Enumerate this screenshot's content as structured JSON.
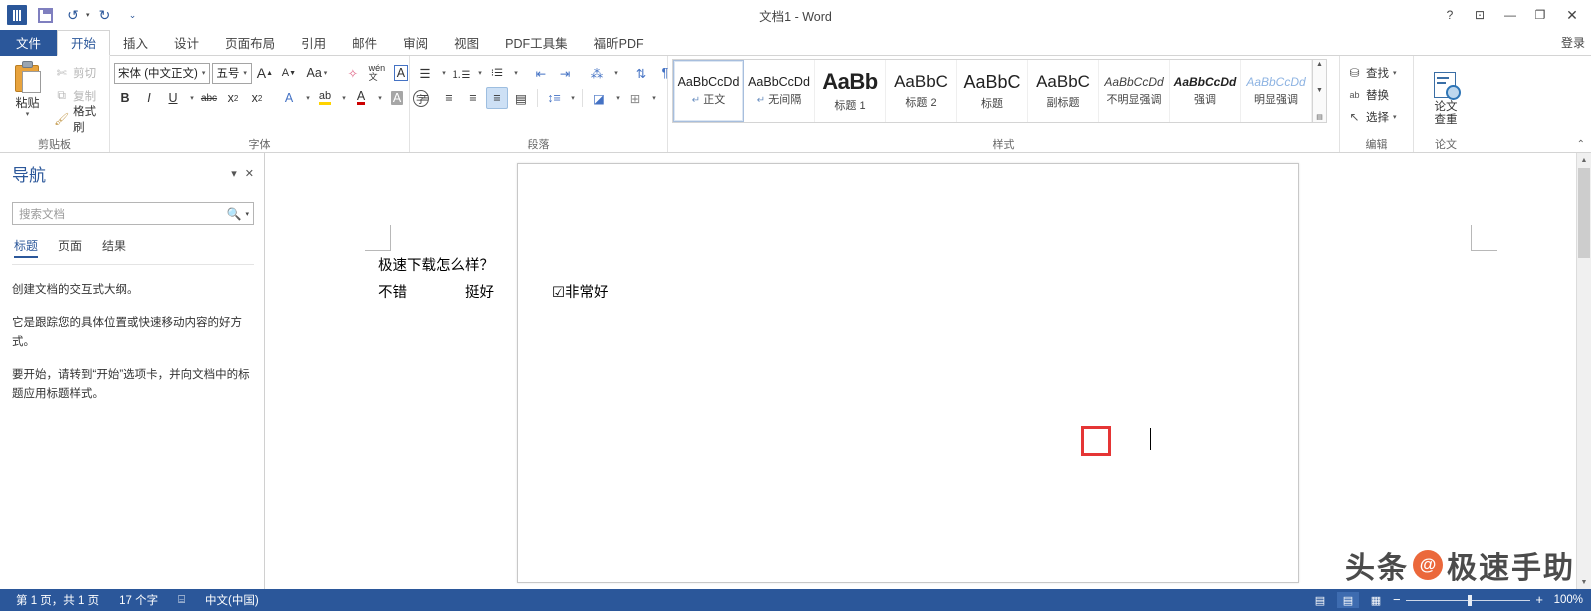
{
  "titlebar": {
    "document_title": "文档1 - Word",
    "quick_access": [
      {
        "name": "word-logo",
        "label": "W"
      },
      {
        "name": "save",
        "label": "保存"
      },
      {
        "name": "undo",
        "label": "↶"
      },
      {
        "name": "redo",
        "label": "↷"
      },
      {
        "name": "customize",
        "label": "⌄"
      }
    ],
    "window_buttons": [
      {
        "name": "help",
        "glyph": "?"
      },
      {
        "name": "ribbon-display-options",
        "glyph": "⊡"
      },
      {
        "name": "minimize",
        "glyph": "—"
      },
      {
        "name": "maximize",
        "glyph": "❐"
      },
      {
        "name": "close",
        "glyph": "✕"
      }
    ]
  },
  "tabs": {
    "file": "文件",
    "items": [
      "开始",
      "插入",
      "设计",
      "页面布局",
      "引用",
      "邮件",
      "审阅",
      "视图",
      "PDF工具集",
      "福昕PDF"
    ],
    "active": "开始",
    "signin": "登录"
  },
  "ribbon": {
    "clipboard": {
      "label": "剪贴板",
      "paste": "粘贴",
      "cut": "剪切",
      "copy": "复制",
      "format_painter": "格式刷"
    },
    "font": {
      "label": "字体",
      "font_name": "宋体 (中文正文)",
      "font_size": "五号",
      "grow_font": "A",
      "shrink_font": "A",
      "change_case": "Aa",
      "clear_format": "✧",
      "phonetic": "wén",
      "char_border": "A",
      "bold": "B",
      "italic": "I",
      "underline": "U",
      "strikethrough": "abc",
      "subscript": "x₂",
      "superscript": "x²",
      "text_effects": "A",
      "highlight": "ab",
      "font_color": "A",
      "char_shading": "A",
      "enclose_char": "字"
    },
    "paragraph": {
      "label": "段落",
      "bullets": "≔",
      "numbering": "≕",
      "multilevel": "≣",
      "decrease_indent": "⇤",
      "increase_indent": "⇥",
      "asian_layout": "⁂",
      "sort": "↓",
      "show_marks": "¶",
      "align_left": "≡",
      "align_center": "≡",
      "align_right": "≡",
      "justify": "≡",
      "distribute": "▤",
      "line_spacing": "↕",
      "shading": "◇",
      "borders": "⊞"
    },
    "styles": {
      "label": "样式",
      "items": [
        {
          "preview": "AaBbCcDd",
          "name": "正文",
          "pilcrow": true,
          "selected": true,
          "kind": "normal"
        },
        {
          "preview": "AaBbCcDd",
          "name": "无间隔",
          "pilcrow": true,
          "selected": false,
          "kind": "normal"
        },
        {
          "preview": "AaBb",
          "name": "标题 1",
          "pilcrow": false,
          "selected": false,
          "kind": "big"
        },
        {
          "preview": "AaBbC",
          "name": "标题 2",
          "pilcrow": false,
          "selected": false,
          "kind": "h1"
        },
        {
          "preview": "AaBbC",
          "name": "标题",
          "pilcrow": false,
          "selected": false,
          "kind": "title"
        },
        {
          "preview": "AaBbC",
          "name": "副标题",
          "pilcrow": false,
          "selected": false,
          "kind": "sub"
        },
        {
          "preview": "AaBbCcDd",
          "name": "不明显强调",
          "pilcrow": false,
          "selected": false,
          "kind": "em"
        },
        {
          "preview": "AaBbCcDd",
          "name": "强调",
          "pilcrow": false,
          "selected": false,
          "kind": "emi"
        },
        {
          "preview": "AaBbCcDd",
          "name": "明显强调",
          "pilcrow": false,
          "selected": false,
          "kind": "emb"
        }
      ]
    },
    "editing": {
      "label": "编辑",
      "find": "查找",
      "replace": "替换",
      "select": "选择"
    },
    "paper": {
      "label": "论文",
      "button_line1": "论文",
      "button_line2": "查重"
    },
    "collapse": "⌃"
  },
  "navigation": {
    "title": "导航",
    "close": "✕",
    "dropdown": "▾",
    "search_placeholder": "搜索文档",
    "search_value": "",
    "tabs": [
      "标题",
      "页面",
      "结果"
    ],
    "active_tab": "标题",
    "help": [
      "创建文档的交互式大纲。",
      "它是跟踪您的具体位置或快速移动内容的好方式。",
      "要开始，请转到“开始”选项卡，并向文档中的标题应用标题样式。"
    ]
  },
  "document": {
    "lines": [
      "极速下载怎么样？",
      {
        "before": "不错　　　　挺好　　　　",
        "checkbox": "☑",
        "after": "非常好"
      }
    ],
    "annotation_color": "#e53535"
  },
  "statusbar": {
    "pages": "第 1 页，共 1 页",
    "words": "17 个字",
    "proofing_icon": "⌸",
    "language": "中文(中国)",
    "views": [
      {
        "name": "read-mode",
        "glyph": "▤"
      },
      {
        "name": "print-layout",
        "glyph": "▤",
        "active": true
      },
      {
        "name": "web-layout",
        "glyph": "▦"
      }
    ],
    "zoom_out": "−",
    "zoom_in": "+",
    "zoom_level": "100%"
  },
  "watermark": {
    "left_text": "头条",
    "badge": "@",
    "right_text": "极速手助"
  }
}
